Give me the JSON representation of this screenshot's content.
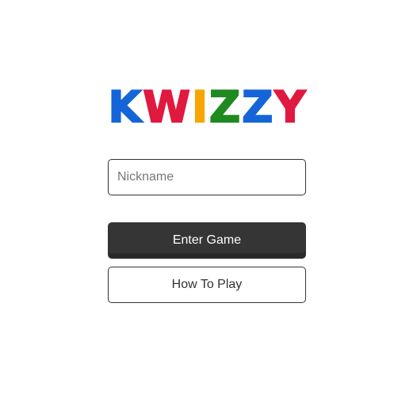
{
  "logo": {
    "letters": [
      {
        "char": "K",
        "color": "#1565d8"
      },
      {
        "char": "W",
        "color": "#e0193f"
      },
      {
        "char": "I",
        "color": "#f7a500"
      },
      {
        "char": "Z",
        "color": "#1f8a1f"
      },
      {
        "char": "Z",
        "color": "#1565d8"
      },
      {
        "char": "Y",
        "color": "#e0193f"
      }
    ]
  },
  "form": {
    "nickname_value": "",
    "nickname_placeholder": "Nickname",
    "enter_label": "Enter Game",
    "howto_label": "How To Play"
  }
}
